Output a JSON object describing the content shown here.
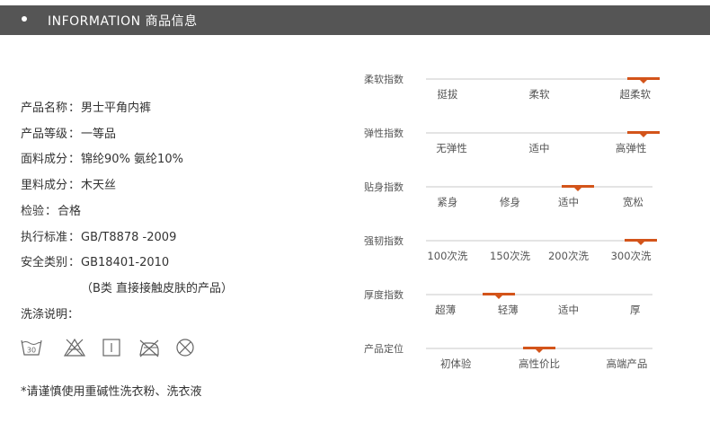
{
  "header": {
    "title": "INFORMATION  商品信息"
  },
  "specs": [
    {
      "label": "产品名称",
      "value": "男士平角内裤"
    },
    {
      "label": "产品等级",
      "value": "一等品"
    },
    {
      "label": "面料成分",
      "value": "锦纶90% 氨纶10%"
    },
    {
      "label": "里料成分",
      "value": "木天丝"
    },
    {
      "label": "检验",
      "value": "合格"
    },
    {
      "label": "执行标准",
      "value": "GB/T8878 -2009"
    },
    {
      "label": "安全类别",
      "value": "GB18401-2010"
    }
  ],
  "spec_separator": "：",
  "safety_note": "（B类 直接接触皮肤的产品）",
  "wash_label": "洗涤说明：",
  "care_icons": [
    {
      "name": "wash-30-icon",
      "text": "30"
    },
    {
      "name": "no-bleach-icon"
    },
    {
      "name": "hang-dry-icon"
    },
    {
      "name": "no-iron-icon"
    },
    {
      "name": "no-tumble-dry-icon"
    }
  ],
  "footnote": "*请谨慎使用重碱性洗衣粉、洗衣液",
  "accent_color": "#d3541a",
  "scales": [
    {
      "name": "柔软指数",
      "labels": [
        "挺拔",
        "柔软",
        "超柔软"
      ],
      "level": 0.96
    },
    {
      "name": "弹性指数",
      "labels": [
        "无弹性",
        "适中",
        "高弹性"
      ],
      "level": 0.96
    },
    {
      "name": "贴身指数",
      "labels": [
        "紧身",
        "修身",
        "适中",
        "宽松"
      ],
      "level": 0.67
    },
    {
      "name": "强韧指数",
      "labels": [
        "100次洗",
        "150次洗",
        "200次洗",
        "300次洗"
      ],
      "level": 0.95
    },
    {
      "name": "厚度指数",
      "labels": [
        "超薄",
        "轻薄",
        "适中",
        "厚"
      ],
      "level": 0.32
    },
    {
      "name": "产品定位",
      "labels": [
        "初体验",
        "高性价比",
        "高端产品"
      ],
      "level": 0.5
    }
  ]
}
